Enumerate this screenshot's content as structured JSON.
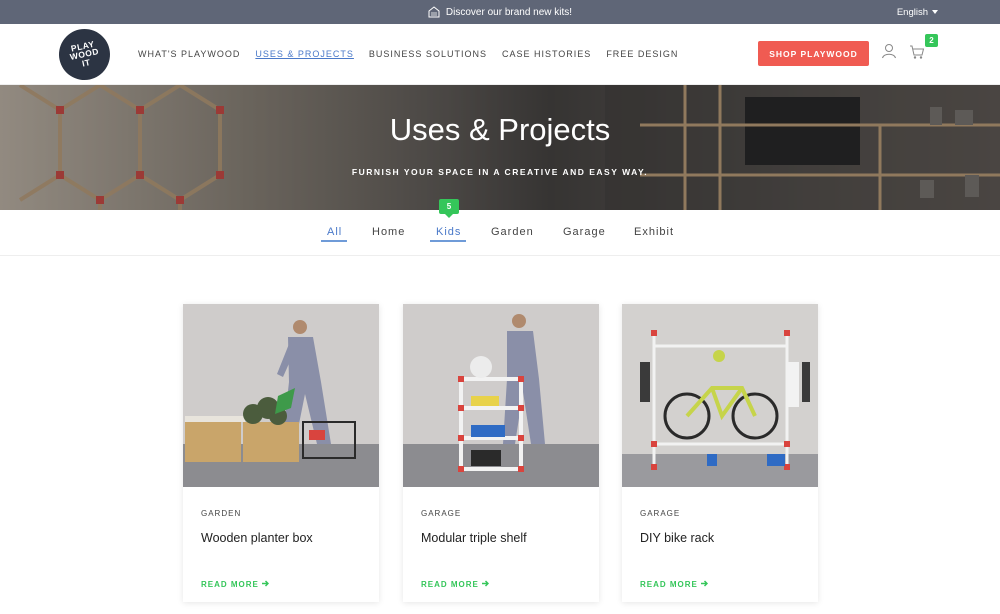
{
  "topbar": {
    "announcement": "Discover our brand new kits!",
    "language": "English"
  },
  "logo": {
    "line1": "PLAY",
    "line2": "WOOD",
    "line3": "IT"
  },
  "nav": {
    "items": [
      {
        "label": "WHAT'S PLAYWOOD",
        "active": false
      },
      {
        "label": "USES & PROJECTS",
        "active": true
      },
      {
        "label": "BUSINESS SOLUTIONS",
        "active": false
      },
      {
        "label": "CASE HISTORIES",
        "active": false
      },
      {
        "label": "FREE DESIGN",
        "active": false
      }
    ],
    "shop_label": "SHOP PLAYWOOD",
    "cart_count": "2"
  },
  "hero": {
    "title": "Uses & Projects",
    "subtitle": "FURNISH YOUR SPACE IN A CREATIVE AND EASY WAY."
  },
  "filters": {
    "tabs": [
      "All",
      "Home",
      "Kids",
      "Garden",
      "Garage",
      "Exhibit"
    ],
    "active": "All",
    "kids_badge": "5"
  },
  "cards": [
    {
      "category": "GARDEN",
      "title": "Wooden planter box",
      "cta": "READ MORE"
    },
    {
      "category": "GARAGE",
      "title": "Modular triple shelf",
      "cta": "READ MORE"
    },
    {
      "category": "GARAGE",
      "title": "DIY bike rack",
      "cta": "READ MORE"
    }
  ],
  "colors": {
    "accent": "#4a79c9",
    "shop": "#f05b52",
    "green": "#35c65a",
    "topbar": "#5f6677",
    "logo": "#2c3443"
  }
}
